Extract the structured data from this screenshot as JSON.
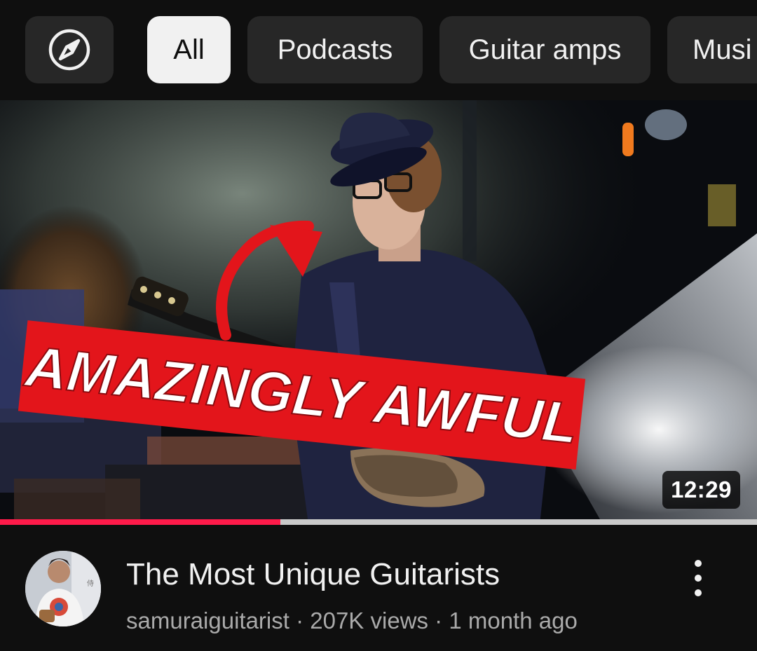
{
  "chips": {
    "explore_icon": "compass-icon",
    "all": "All",
    "podcasts": "Podcasts",
    "guitar_amps": "Guitar amps",
    "music": "Musi"
  },
  "video": {
    "thumbnail_text": "AMAZINGLY AWFUL",
    "duration": "12:29",
    "watch_progress": 0.37,
    "title": "The Most Unique Guitarists",
    "channel": "samuraiguitarist",
    "views": "207K views",
    "age": "1 month ago",
    "separator": " · ",
    "more_icon": "more-vert-icon"
  },
  "colors": {
    "background": "#0f0f0f",
    "chip": "#272727",
    "chip_selected": "#f1f1f1",
    "progress": "#ff1b4a",
    "banner": "#e3151b"
  }
}
